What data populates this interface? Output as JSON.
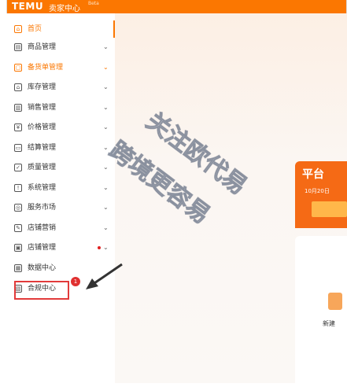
{
  "header": {
    "logo": "TEMU",
    "subtitle": "卖家中心",
    "beta": "Beta"
  },
  "sidebar": {
    "items": [
      {
        "label": "首页",
        "icon": "home-icon",
        "glyph": "⌂",
        "active": true
      },
      {
        "label": "商品管理",
        "icon": "product-icon",
        "glyph": "▤",
        "chevron": "⌄"
      },
      {
        "label": "备货单管理",
        "icon": "order-icon",
        "glyph": "▢",
        "chevron": "⌄",
        "active": true
      },
      {
        "label": "库存管理",
        "icon": "warehouse-icon",
        "glyph": "⌂",
        "chevron": "⌄"
      },
      {
        "label": "销售管理",
        "icon": "sales-icon",
        "glyph": "▥",
        "chevron": "⌄"
      },
      {
        "label": "价格管理",
        "icon": "price-icon",
        "glyph": "¥",
        "chevron": "⌄"
      },
      {
        "label": "结算管理",
        "icon": "settlement-icon",
        "glyph": "▭",
        "chevron": "⌄"
      },
      {
        "label": "质量管理",
        "icon": "quality-icon",
        "glyph": "✓",
        "chevron": "⌄"
      },
      {
        "label": "系统管理",
        "icon": "system-icon",
        "glyph": "!",
        "chevron": "⌄"
      },
      {
        "label": "服务市场",
        "icon": "market-icon",
        "glyph": "◎",
        "chevron": "⌄"
      },
      {
        "label": "店铺营销",
        "icon": "marketing-icon",
        "glyph": "✎",
        "chevron": "⌄"
      },
      {
        "label": "店铺管理",
        "icon": "shop-icon",
        "glyph": "▣",
        "chevron": "⌄"
      },
      {
        "label": "数据中心",
        "icon": "data-icon",
        "glyph": "▦"
      },
      {
        "label": "合规中心",
        "icon": "compliance-icon",
        "glyph": "▧"
      }
    ]
  },
  "annotation": {
    "badge": "1"
  },
  "banner": {
    "title": "平台",
    "date": "10月20日"
  },
  "card": {
    "label": "新建"
  },
  "watermark": {
    "line1": "关注欧代易",
    "line2": "跨境更容易"
  },
  "colors": {
    "brand": "#fb7701",
    "highlight": "#e23b3b"
  }
}
